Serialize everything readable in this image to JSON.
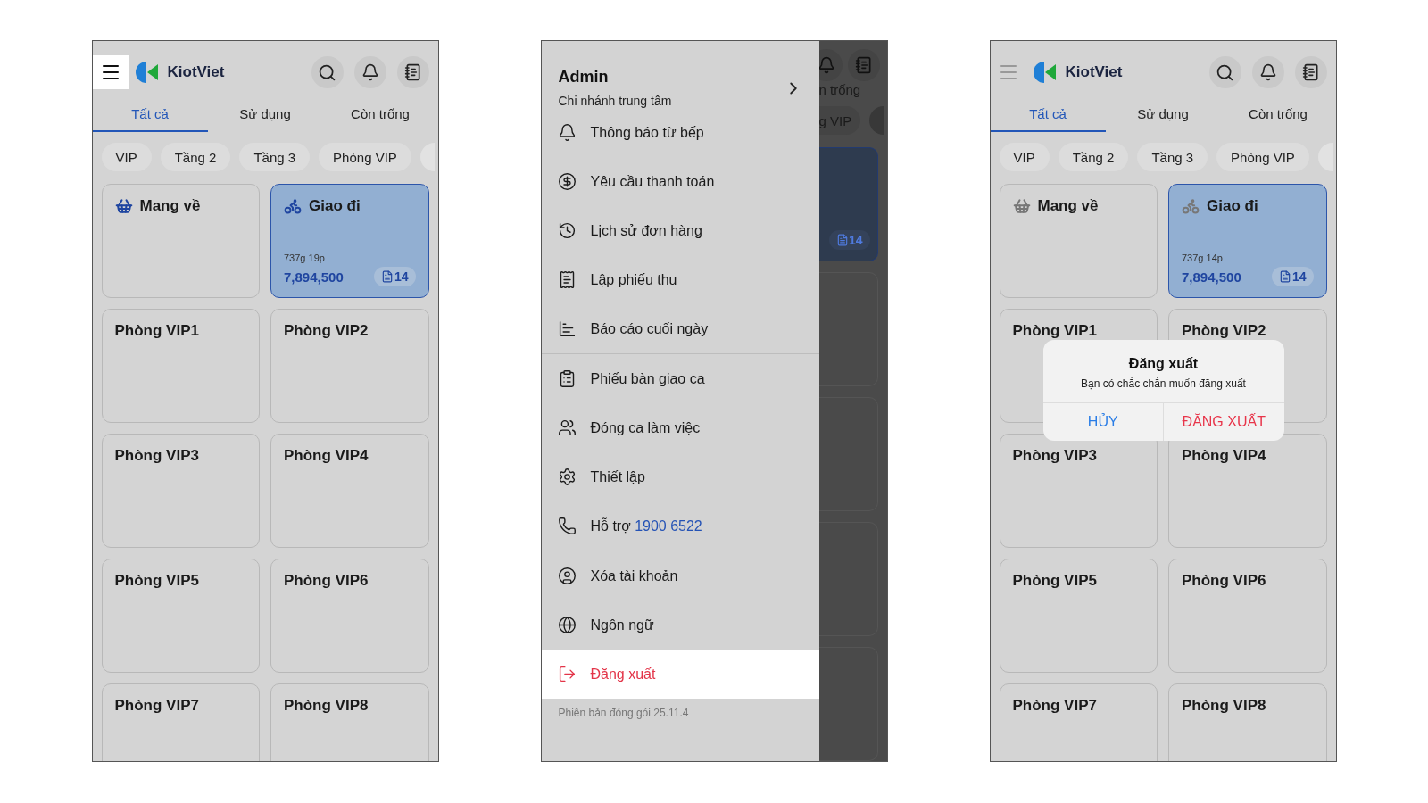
{
  "screens": [
    {
      "kind": "home",
      "logo": "KiotViet",
      "menu_highlighted": true,
      "tabs": [
        {
          "label": "Tất cả",
          "selected": true
        },
        {
          "label": "Sử dụng",
          "selected": false
        },
        {
          "label": "Còn trống",
          "selected": false
        }
      ],
      "chips": [
        "VIP",
        "Tầng 2",
        "Tầng 3",
        "Phòng VIP"
      ],
      "cards": [
        {
          "kind": "takeaway",
          "title": "Mang về",
          "selected": false
        },
        {
          "kind": "delivery",
          "title": "Giao đi",
          "selected": true,
          "time": "737g 19p",
          "amount": "7,894,500",
          "orders": "14"
        },
        {
          "kind": "table",
          "title": "Phòng VIP1",
          "selected": false
        },
        {
          "kind": "table",
          "title": "Phòng VIP2",
          "selected": false
        },
        {
          "kind": "table",
          "title": "Phòng VIP3",
          "selected": false
        },
        {
          "kind": "table",
          "title": "Phòng VIP4",
          "selected": false
        },
        {
          "kind": "table",
          "title": "Phòng VIP5",
          "selected": false
        },
        {
          "kind": "table",
          "title": "Phòng VIP6",
          "selected": false
        },
        {
          "kind": "table",
          "title": "Phòng VIP7",
          "selected": false
        },
        {
          "kind": "table",
          "title": "Phòng VIP8",
          "selected": false
        }
      ]
    },
    {
      "kind": "drawer",
      "user": "Admin",
      "branch": "Chi nhánh trung tâm",
      "sections": [
        {
          "items": [
            {
              "kind": "kitchen",
              "label": "Thông báo từ bếp",
              "selected": false
            },
            {
              "kind": "payment",
              "label": "Yêu cầu thanh toán",
              "selected": false
            },
            {
              "kind": "history",
              "label": "Lịch sử đơn hàng",
              "selected": false
            },
            {
              "kind": "receipt",
              "label": "Lập phiếu thu",
              "selected": false
            },
            {
              "kind": "report",
              "label": "Báo cáo cuối ngày",
              "selected": false
            }
          ]
        },
        {
          "items": [
            {
              "kind": "handover",
              "label": "Phiếu bàn giao ca",
              "selected": false
            },
            {
              "kind": "shift",
              "label": "Đóng ca làm việc",
              "selected": false
            },
            {
              "kind": "settings",
              "label": "Thiết lập",
              "selected": false
            },
            {
              "kind": "support",
              "label": "Hỗ trợ",
              "phone": "1900 6522",
              "selected": false
            }
          ]
        },
        {
          "items": [
            {
              "kind": "account",
              "label": "Xóa tài khoản",
              "selected": false
            },
            {
              "kind": "language",
              "label": "Ngôn ngữ",
              "selected": false
            },
            {
              "kind": "logout",
              "label": "Đăng xuất",
              "selected": true
            }
          ]
        }
      ],
      "version": "Phiên bản đóng gói 25.11.4",
      "behind": {
        "tab_fragment": "n trống",
        "chip_fragment": "g VIP",
        "orders": "14"
      }
    },
    {
      "kind": "home",
      "logo": "KiotViet",
      "menu_highlighted": false,
      "tabs": [
        {
          "label": "Tất cả",
          "selected": true
        },
        {
          "label": "Sử dụng",
          "selected": false
        },
        {
          "label": "Còn trống",
          "selected": false
        }
      ],
      "chips": [
        "VIP",
        "Tầng 2",
        "Tầng 3",
        "Phòng VIP"
      ],
      "cards": [
        {
          "kind": "takeaway",
          "title": "Mang về",
          "selected": false
        },
        {
          "kind": "delivery",
          "title": "Giao đi",
          "selected": true,
          "time": "737g 14p",
          "amount": "7,894,500",
          "orders": "14"
        },
        {
          "kind": "table",
          "title": "Phòng VIP1",
          "selected": false
        },
        {
          "kind": "table",
          "title": "Phòng VIP2",
          "selected": false
        },
        {
          "kind": "table",
          "title": "Phòng VIP3",
          "selected": false
        },
        {
          "kind": "table",
          "title": "Phòng VIP4",
          "selected": false
        },
        {
          "kind": "table",
          "title": "Phòng VIP5",
          "selected": false
        },
        {
          "kind": "table",
          "title": "Phòng VIP6",
          "selected": false
        },
        {
          "kind": "table",
          "title": "Phòng VIP7",
          "selected": false
        },
        {
          "kind": "table",
          "title": "Phòng VIP8",
          "selected": false
        }
      ],
      "dialog": {
        "title": "Đăng xuất",
        "message": "Bạn có chắc chắn muốn đăng xuất",
        "buttons": [
          {
            "kind": "cancel",
            "label": "HỦY"
          },
          {
            "kind": "destructive",
            "label": "ĐĂNG XUẤT"
          }
        ]
      }
    }
  ]
}
